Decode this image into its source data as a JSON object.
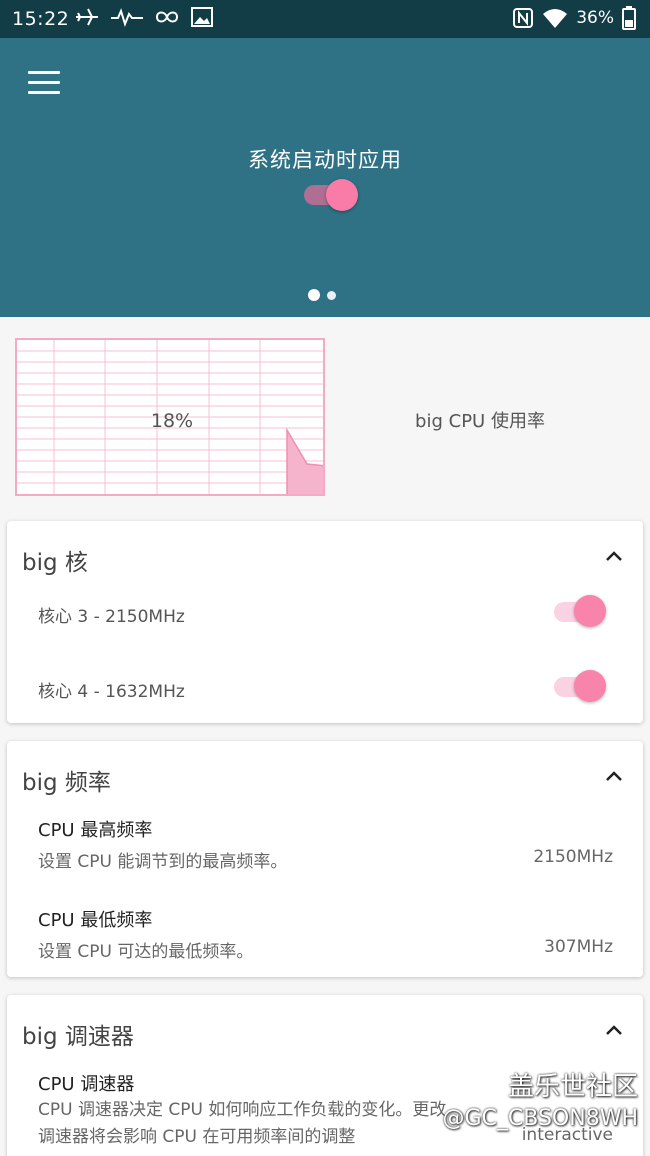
{
  "status_bar": {
    "time": "15:22",
    "battery": "36%",
    "icons": [
      "airplane-icon",
      "pulse-icon",
      "infinity-icon",
      "image-icon",
      "nfc-icon",
      "wifi-icon",
      "battery-icon"
    ]
  },
  "header": {
    "title": "系统启动时应用",
    "toggle_on": true,
    "page_count": 2,
    "active_page": 0
  },
  "cpu_usage": {
    "value": "18%",
    "label": "big CPU 使用率",
    "usage_fraction": 0.18
  },
  "cores_card": {
    "title": "big 核",
    "cores": [
      {
        "label": "核心 3 - 2150MHz",
        "enabled": true
      },
      {
        "label": "核心 4 - 1632MHz",
        "enabled": true
      }
    ]
  },
  "freq_card": {
    "title": "big 频率",
    "items": [
      {
        "title": "CPU 最高频率",
        "subtitle": "设置 CPU 能调节到的最高频率。",
        "value": "2150MHz"
      },
      {
        "title": "CPU 最低频率",
        "subtitle": "设置 CPU 可达的最低频率。",
        "value": "307MHz"
      }
    ]
  },
  "governor_card": {
    "title": "big 调速器",
    "item": {
      "title": "CPU 调速器",
      "subtitle": "CPU 调速器决定 CPU 如何响应工作负载的变化。更改调速器将会影响 CPU 在可用频率间的调整",
      "value": "interactive"
    }
  },
  "watermark": {
    "line1": "盖乐世社区",
    "line2": "@GC_CBSON8WH"
  },
  "colors": {
    "header_bg": "#2f7185",
    "status_bg": "#123c46",
    "accent": "#f984ab",
    "graph_line": "#f4a9c4"
  }
}
